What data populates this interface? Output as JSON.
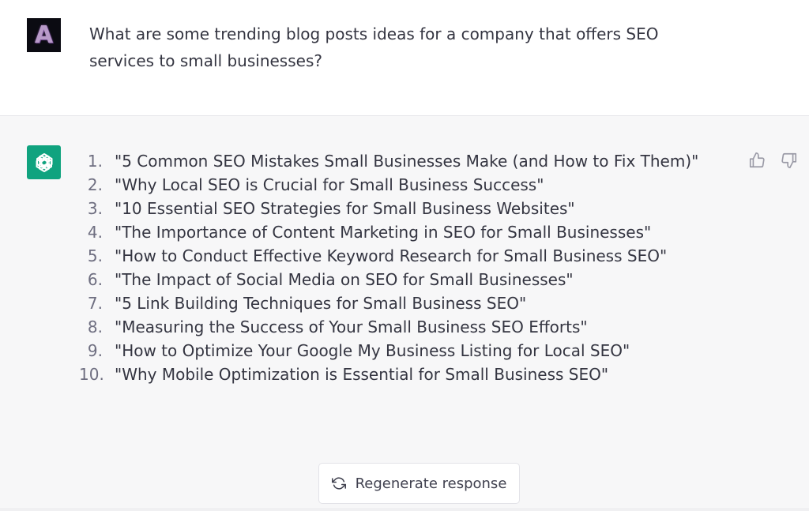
{
  "user_message": {
    "avatar_letter": "A",
    "text": "What are some trending blog posts ideas for a company that offers SEO services to small businesses?"
  },
  "assistant_message": {
    "items": [
      {
        "number": "1.",
        "text": "\"5 Common SEO Mistakes Small Businesses Make (and How to Fix Them)\""
      },
      {
        "number": "2.",
        "text": "\"Why Local SEO is Crucial for Small Business Success\""
      },
      {
        "number": "3.",
        "text": "\"10 Essential SEO Strategies for Small Business Websites\""
      },
      {
        "number": "4.",
        "text": "\"The Importance of Content Marketing in SEO for Small Businesses\""
      },
      {
        "number": "5.",
        "text": "\"How to Conduct Effective Keyword Research for Small Business SEO\""
      },
      {
        "number": "6.",
        "text": "\"The Impact of Social Media on SEO for Small Businesses\""
      },
      {
        "number": "7.",
        "text": "\"5 Link Building Techniques for Small Business SEO\""
      },
      {
        "number": "8.",
        "text": "\"Measuring the Success of Your Small Business SEO Efforts\""
      },
      {
        "number": "9.",
        "text": "\"How to Optimize Your Google My Business Listing for Local SEO\""
      },
      {
        "number": "10.",
        "text": "\"Why Mobile Optimization is Essential for Small Business SEO\""
      }
    ]
  },
  "actions": {
    "regenerate_label": "Regenerate response"
  },
  "icons": {
    "thumbs_up": "thumbs-up-icon",
    "thumbs_down": "thumbs-down-icon",
    "regenerate": "refresh-icon",
    "assistant_logo": "openai-logo-icon"
  },
  "colors": {
    "assistant_avatar_bg": "#10a37f",
    "assistant_block_bg": "#f7f7f8",
    "text": "#343541"
  }
}
